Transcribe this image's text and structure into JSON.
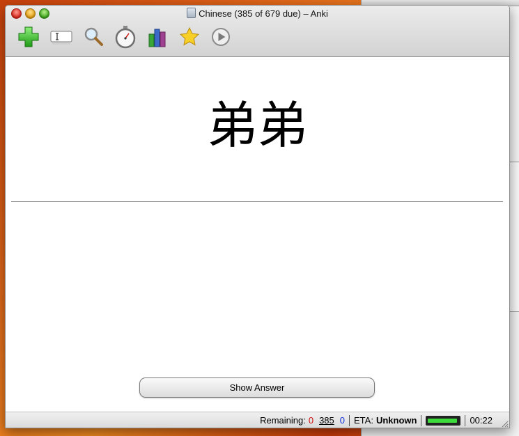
{
  "window": {
    "title": "Chinese (385 of 679 due) – Anki"
  },
  "toolbar": {
    "buttons": [
      {
        "name": "add-button",
        "icon": "plus-icon"
      },
      {
        "name": "edit-button",
        "icon": "text-field-icon"
      },
      {
        "name": "search-button",
        "icon": "magnifier-icon"
      },
      {
        "name": "timer-button",
        "icon": "stopwatch-icon"
      },
      {
        "name": "graphs-button",
        "icon": "bar-chart-icon"
      },
      {
        "name": "mark-button",
        "icon": "star-icon"
      },
      {
        "name": "play-button",
        "icon": "play-icon"
      }
    ]
  },
  "card": {
    "question": "弟弟"
  },
  "actions": {
    "show_answer_label": "Show Answer"
  },
  "status": {
    "remaining_label": "Remaining:",
    "new_count": "0",
    "review_count": "385",
    "learning_count": "0",
    "eta_label": "ETA:",
    "eta_value": "Unknown",
    "progress_fraction": 0.95,
    "timer": "00:22"
  },
  "colors": {
    "new_count": "#d0100c",
    "learning_count": "#1030d8",
    "progress_fill": "#3bdc3b"
  }
}
